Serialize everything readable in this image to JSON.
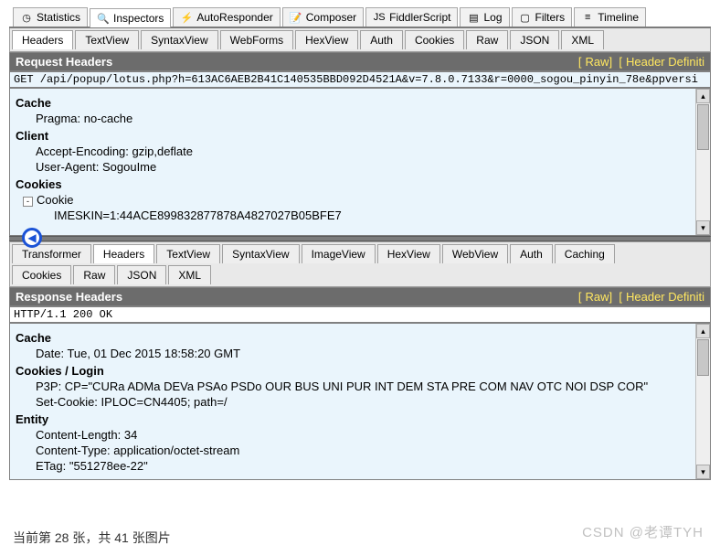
{
  "topbar": [
    {
      "icon": "◷",
      "label": "Statistics",
      "name": "tab-statistics"
    },
    {
      "icon": "🔍",
      "label": "Inspectors",
      "name": "tab-inspectors",
      "active": true
    },
    {
      "icon": "⚡",
      "label": "AutoResponder",
      "name": "tab-autoresponder"
    },
    {
      "icon": "📝",
      "label": "Composer",
      "name": "tab-composer"
    },
    {
      "icon": "JS",
      "label": "FiddlerScript",
      "name": "tab-fiddlerscript"
    },
    {
      "icon": "▤",
      "label": "Log",
      "name": "tab-log"
    },
    {
      "icon": "▢",
      "label": "Filters",
      "name": "tab-filters"
    },
    {
      "icon": "≡",
      "label": "Timeline",
      "name": "tab-timeline"
    }
  ],
  "reqTabs": [
    "Headers",
    "TextView",
    "SyntaxView",
    "WebForms",
    "HexView",
    "Auth",
    "Cookies",
    "Raw",
    "JSON",
    "XML"
  ],
  "reqActive": 0,
  "reqHeaderTitle": "Request Headers",
  "reqLinks": {
    "raw": "Raw",
    "def": "Header Definiti"
  },
  "reqLine": "GET /api/popup/lotus.php?h=613AC6AEB2B41C140535BBD092D4521A&v=7.8.0.7133&r=0000_sogou_pinyin_78e&ppversi",
  "req": {
    "groups": [
      {
        "name": "Cache",
        "items": [
          {
            "k": "Pragma",
            "v": "no-cache"
          }
        ]
      },
      {
        "name": "Client",
        "items": [
          {
            "k": "Accept-Encoding",
            "v": "gzip,deflate"
          },
          {
            "k": "User-Agent",
            "v": "SogouIme"
          }
        ]
      },
      {
        "name": "Cookies",
        "tree": {
          "label": "Cookie",
          "children": [
            {
              "k": "IMESKIN",
              "v": "1:44ACE899832877878A4827027B05BFE7"
            }
          ]
        }
      }
    ]
  },
  "respTabs1": [
    "Transformer",
    "Headers",
    "TextView",
    "SyntaxView",
    "ImageView",
    "HexView",
    "WebView",
    "Auth",
    "Caching"
  ],
  "respTabs2": [
    "Cookies",
    "Raw",
    "JSON",
    "XML"
  ],
  "respActive": 1,
  "respHeaderTitle": "Response Headers",
  "respLinks": {
    "raw": "Raw",
    "def": "Header Definiti"
  },
  "statusLine": "HTTP/1.1 200 OK",
  "resp": {
    "groups": [
      {
        "name": "Cache",
        "items": [
          {
            "k": "Date",
            "v": "Tue, 01 Dec 2015 18:58:20 GMT"
          }
        ]
      },
      {
        "name": "Cookies / Login",
        "items": [
          {
            "k": "P3P",
            "v": "CP=\"CURa ADMa DEVa PSAo PSDo OUR BUS UNI PUR INT DEM STA PRE COM NAV OTC NOI DSP COR\""
          },
          {
            "k": "Set-Cookie",
            "v": "IPLOC=CN4405; path=/"
          }
        ]
      },
      {
        "name": "Entity",
        "items": [
          {
            "k": "Content-Length",
            "v": "34"
          },
          {
            "k": "Content-Type",
            "v": "application/octet-stream"
          },
          {
            "k": "ETag",
            "v": "\"551278ee-22\""
          }
        ]
      }
    ]
  },
  "footer": "当前第 28 张，共 41 张图片",
  "watermark": "CSDN @老谭TYH"
}
